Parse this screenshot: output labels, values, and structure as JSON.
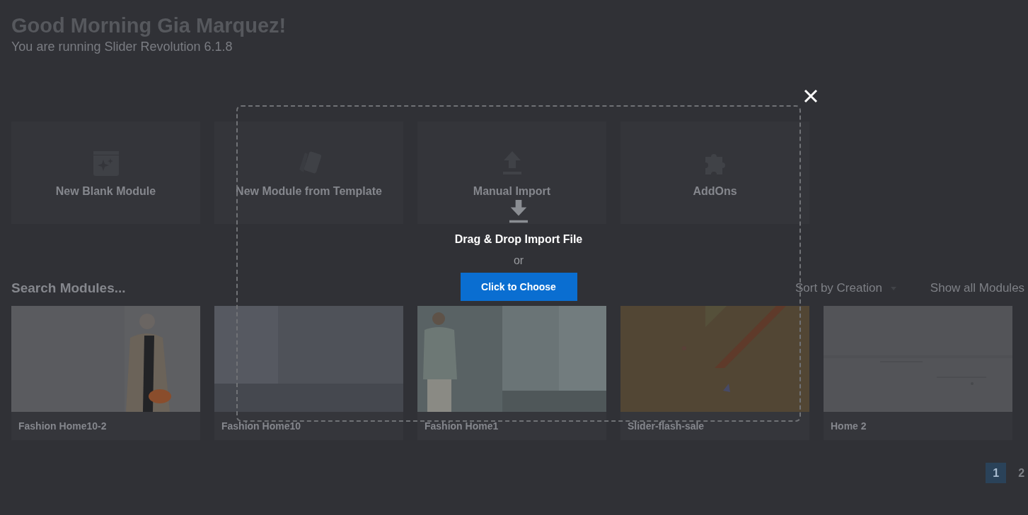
{
  "header": {
    "title": "Good Morning Gia Marquez!",
    "subtitle": "You are running Slider Revolution 6.1.8"
  },
  "actions": [
    {
      "kind": "blank",
      "label": "New Blank Module"
    },
    {
      "kind": "template",
      "label": "New Module from Template"
    },
    {
      "kind": "import",
      "label": "Manual Import"
    },
    {
      "kind": "addons",
      "label": "AddOns"
    }
  ],
  "toolbar": {
    "search_placeholder": "Search Modules...",
    "sort": "Sort by Creation",
    "filter": "Show all Modules"
  },
  "modules": [
    {
      "title": "Fashion Home10-2"
    },
    {
      "title": "Fashion Home10"
    },
    {
      "title": "Fashion Home1"
    },
    {
      "title": "Slider-flash-sale"
    },
    {
      "title": "Home 2"
    }
  ],
  "pagination": [
    {
      "label": "1",
      "selected": true
    },
    {
      "label": "2",
      "selected": false
    }
  ],
  "import_dialog": {
    "heading": "Drag & Drop Import File",
    "or": "or",
    "button": "Click to Choose"
  }
}
